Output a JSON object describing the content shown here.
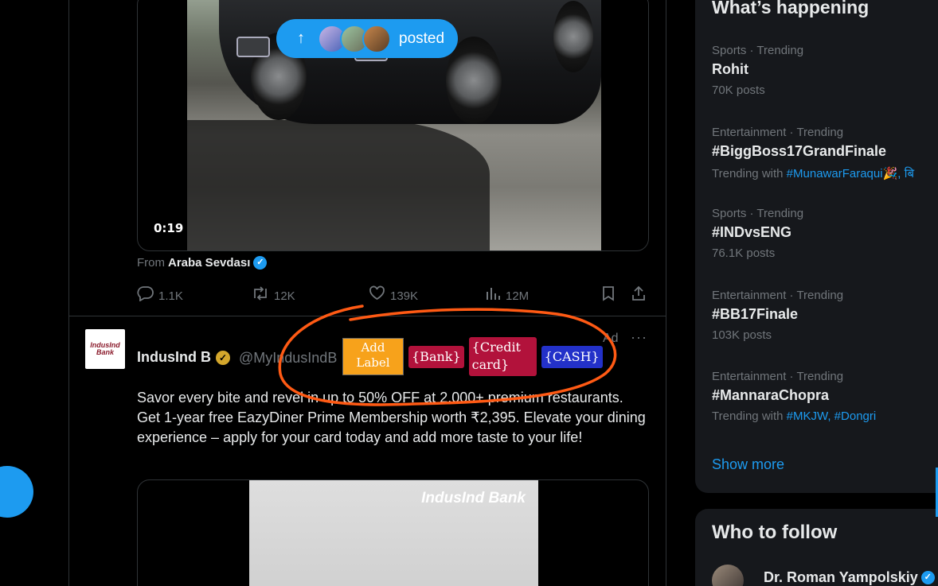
{
  "feed": {
    "video": {
      "time": "0:19",
      "posted_label": "posted",
      "from_prefix": "From",
      "from_account": "Araba Sevdası"
    },
    "actions": {
      "replies": "1.1K",
      "reposts": "12K",
      "likes": "139K",
      "views": "12M"
    },
    "ad": {
      "avatar_text": "IndusInd Bank",
      "name": "IndusInd B",
      "handle": "@MyIndusIndB",
      "ad_tag": "Ad",
      "more": "···",
      "body": "Savor every bite and revel in up to 50% OFF at 2,000+ premium restaurants. Get 1-year free EazyDiner Prime Membership worth ₹2,395. Elevate your dining experience – apply for your card today and add more taste to your life!",
      "media_brand": "IndusInd Bank"
    }
  },
  "labels": {
    "add": "Add Label",
    "bank": "{Bank}",
    "credit": "{Credit card}",
    "cash": "{CASH}"
  },
  "sidebar": {
    "title": "What’s happening",
    "trends": [
      {
        "meta": "Sports · Trending",
        "name": "Rohit",
        "sub": "70K posts"
      },
      {
        "meta": "Entertainment · Trending",
        "name": "#BiggBoss17GrandFinale",
        "sub_prefix": "Trending with",
        "sub_links": "#MunawarFaraqui🎉, बि"
      },
      {
        "meta": "Sports · Trending",
        "name": "#INDvsENG",
        "sub": "76.1K posts"
      },
      {
        "meta": "Entertainment · Trending",
        "name": "#BB17Finale",
        "sub": "103K posts"
      },
      {
        "meta": "Entertainment · Trending",
        "name": "#MannaraChopra",
        "sub_prefix": "Trending with",
        "sub_links": "#MKJW, #Dongri"
      }
    ],
    "show_more": "Show more",
    "who_title": "Who to follow",
    "who_name": "Dr. Roman Yampolskiy"
  },
  "colors": {
    "accent": "#1d9bf0",
    "annotation_circle": "#ff5a14",
    "label_add": "#f7a21b",
    "label_red": "#b2123b",
    "label_blue": "#2331c9"
  }
}
